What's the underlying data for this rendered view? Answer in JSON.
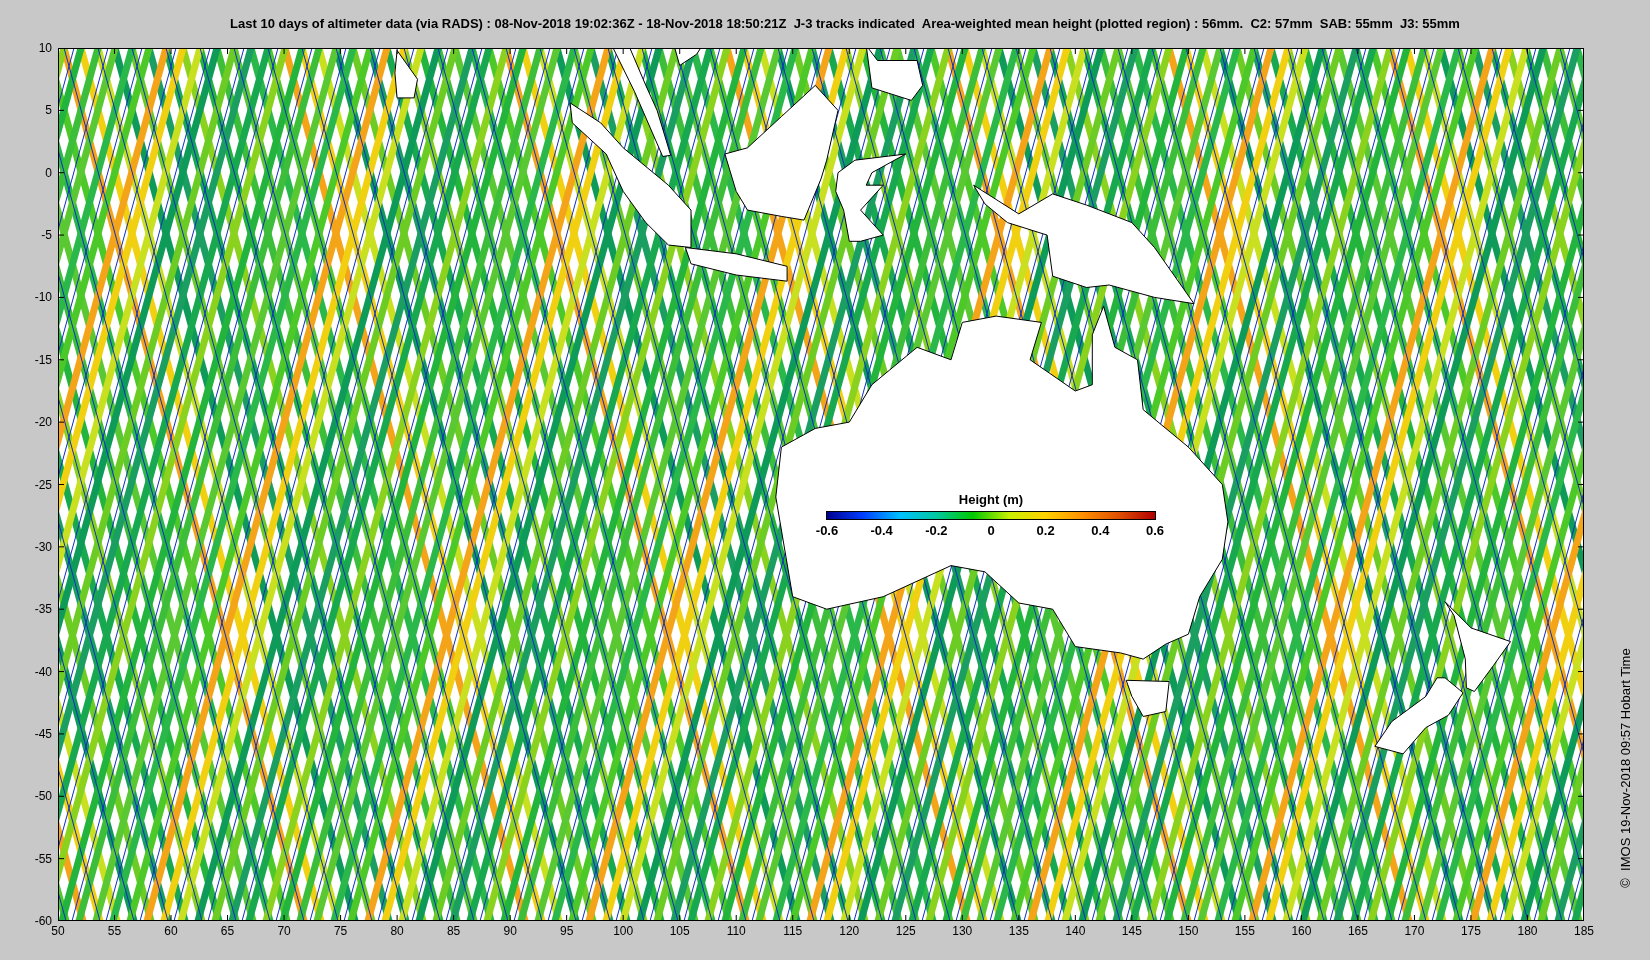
{
  "title": "Last 10 days of altimeter data (via RADS) : 08-Nov-2018 19:02:36Z - 18-Nov-2018 18:50:21Z  J-3 tracks indicated  Area-weighted mean height (plotted region) : 56mm.  C2: 57mm  SAB: 55mm  J3: 55mm",
  "map": {
    "y_tick_labels": [
      "10",
      "5",
      "0",
      "-5",
      "-10",
      "-15",
      "-20",
      "-25",
      "-30",
      "-35",
      "-40",
      "-45",
      "-50",
      "-55",
      "-60"
    ],
    "x_tick_labels": [
      "50",
      "55",
      "60",
      "65",
      "70",
      "75",
      "80",
      "85",
      "90",
      "95",
      "100",
      "105",
      "110",
      "115",
      "120",
      "125",
      "130",
      "135",
      "140",
      "145",
      "150",
      "155",
      "160",
      "165",
      "170",
      "175",
      "180",
      "185"
    ]
  },
  "colorbar": {
    "title": "Height (m)",
    "tick_labels": [
      "-0.6",
      "-0.4",
      "-0.2",
      "0",
      "0.2",
      "0.4",
      "0.6"
    ]
  },
  "credit": "©  IMOS 19-Nov-2018 09:57 Hobart Time"
}
